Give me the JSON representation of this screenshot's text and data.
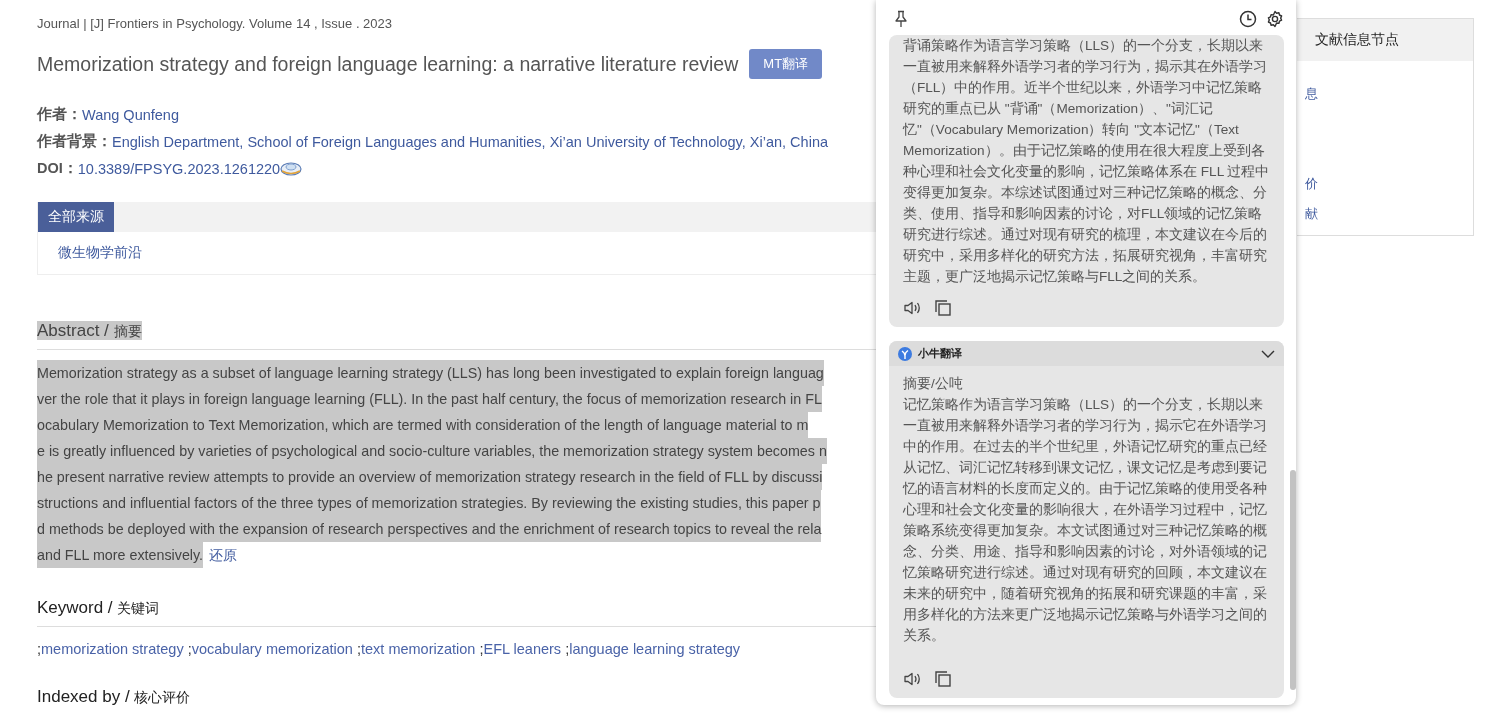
{
  "article": {
    "breadcrumb": "Journal | [J] Frontiers in Psychology. Volume 14 , Issue . 2023",
    "title": "Memorization strategy and foreign language learning: a narrative literature review",
    "translate_button": "MT翻译",
    "meta": [
      {
        "label": "作者：",
        "value": "Wang Qunfeng",
        "kind": "text"
      },
      {
        "label": "作者背景：",
        "value": "English Department, School of Foreign Languages and Humanities, Xi’an University of Technology, Xi’an, China",
        "kind": "text"
      },
      {
        "label": "DOI：",
        "value": "10.3389/FPSYG.2023.1261220",
        "kind": "doi"
      }
    ],
    "source_tabs": [
      {
        "label": "全部来源",
        "selected": true
      }
    ],
    "sources": [
      "微生物学前沿"
    ],
    "abstract": {
      "heading": "Abstract / ",
      "heading_cn": "摘要",
      "highlighted": true,
      "lines": [
        "Memorization strategy as a subset of language learning strategy (LLS) has long been investigated to explain foreign languag",
        "ver the role that it plays in foreign language learning (FLL). In the past half century, the focus of memorization research in FL",
        "ocabulary Memorization to Text Memorization, which are termed with consideration of the length of language material to m",
        "e is greatly influenced by varieties of psychological and socio-culture variables, the memorization strategy system becomes n",
        "he present narrative review attempts to provide an overview of memorization strategy research in the field of FLL by discussi",
        "structions and influential factors of the three types of memorization strategies. By reviewing the existing studies, this paper p",
        "d methods be deployed with the expansion of research perspectives and the enrichment of research topics to reveal the rela",
        "and FLL more extensively. "
      ],
      "restore_link": "还原"
    },
    "keywords": {
      "heading": "Keyword / ",
      "heading_cn": "关键词",
      "items": [
        {
          "sep": ";",
          "text": "memorization strategy "
        },
        {
          "sep": ";",
          "text": "vocabulary memorization "
        },
        {
          "sep": ";",
          "text": "text memorization "
        },
        {
          "sep": ";",
          "text": "EFL leaners "
        },
        {
          "sep": ";",
          "text": "language learning strategy"
        }
      ]
    },
    "indexed": {
      "heading": "Indexed by / ",
      "heading_cn": "核心评价"
    }
  },
  "sidebar": {
    "title": "文献信息节点",
    "items": [
      "息",
      "价",
      "献"
    ]
  },
  "translation_panel": {
    "cards": [
      {
        "text": "背诵策略作为语言学习策略（LLS）的一个分支，长期以来一直被用来解释外语学习者的学习行为，揭示其在外语学习（FLL）中的作用。近半个世纪以来，外语学习中记忆策略研究的重点已从 \"背诵\"（Memorization）、\"词汇记忆\"（Vocabulary Memorization）转向 \"文本记忆\"（Text Memorization）。由于记忆策略的使用在很大程度上受到各种心理和社会文化变量的影响，记忆策略体系在 FLL 过程中变得更加复杂。本综述试图通过对三种记忆策略的概念、分类、使用、指导和影响因素的讨论，对FLL领域的记忆策略研究进行综述。通过对现有研究的梳理，本文建议在今后的研究中，采用多样化的研究方法，拓展研究视角，丰富研究主题，更广泛地揭示记忆策略与FLL之间的关系。"
      },
      {
        "engine": "小牛翻译",
        "expanded": true,
        "heading": "摘要/公吨",
        "text": "记忆策略作为语言学习策略（LLS）的一个分支，长期以来一直被用来解释外语学习者的学习行为，揭示它在外语学习中的作用。在过去的半个世纪里，外语记忆研究的重点已经从记忆、词汇记忆转移到课文记忆，课文记忆是考虑到要记忆的语言材料的长度而定义的。由于记忆策略的使用受各种心理和社会文化变量的影响很大，在外语学习过程中，记忆策略系统变得更加复杂。本文试图通过对三种记忆策略的概念、分类、用途、指导和影响因素的讨论，对外语领域的记忆策略研究进行综述。通过对现有研究的回顾，本文建议在未来的研究中，随着研究视角的拓展和研究课题的丰富，采用多样化的方法来更广泛地揭示记忆策略与外语学习之间的关系。"
      }
    ]
  }
}
